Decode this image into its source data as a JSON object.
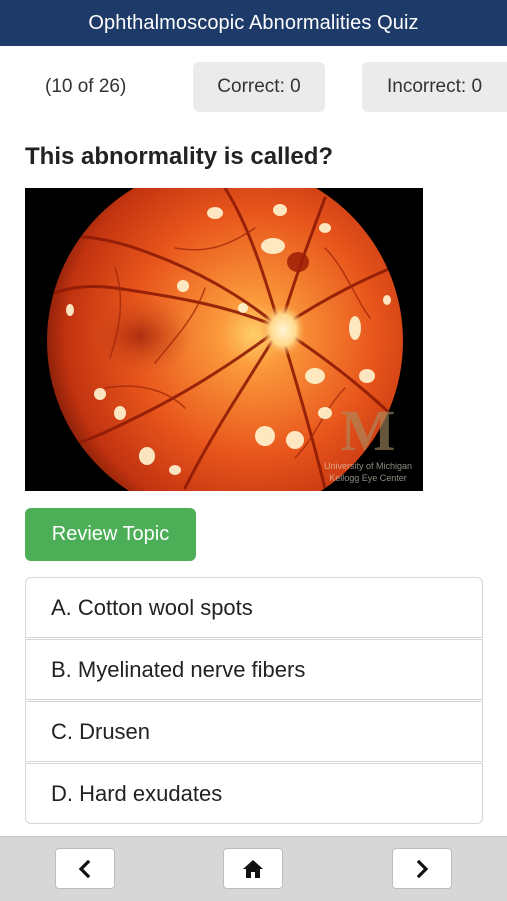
{
  "header": {
    "title": "Ophthalmoscopic Abnormalities Quiz"
  },
  "status": {
    "progress": "(10 of 26)",
    "correct": "Correct: 0",
    "incorrect": "Incorrect: 0"
  },
  "question": {
    "text": "This abnormality is called?"
  },
  "image": {
    "watermark_line1": "University of Michigan",
    "watermark_line2": "Kellogg Eye Center",
    "watermark_logo": "M"
  },
  "review_button": {
    "label": "Review Topic"
  },
  "answers": [
    {
      "label": "A. Cotton wool spots"
    },
    {
      "label": "B. Myelinated nerve fibers"
    },
    {
      "label": "C. Drusen"
    },
    {
      "label": "D. Hard exudates"
    }
  ],
  "bottom_nav": {
    "prev_icon": "chevron-left-icon",
    "home_icon": "home-icon",
    "next_icon": "chevron-right-icon"
  },
  "colors": {
    "header_bg": "#1d3a68",
    "review_button_bg": "#4caf58",
    "pill_bg": "#ebebeb",
    "bottom_bar_bg": "#d7d7d7"
  }
}
